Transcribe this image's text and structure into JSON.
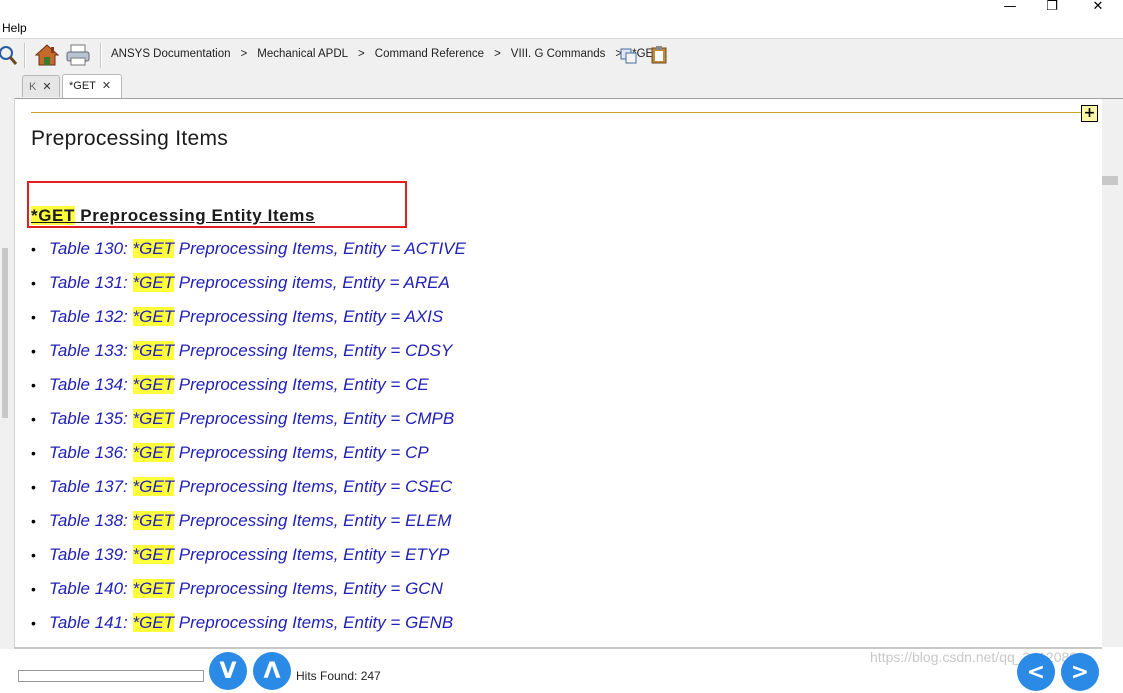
{
  "window": {
    "minimize": "—",
    "restore": "❐",
    "close": "✕"
  },
  "menu": {
    "help": "Help"
  },
  "toolbar": {
    "breadcrumbs": [
      "ANSYS Documentation",
      "Mechanical APDL",
      "Command Reference",
      "VIII. G Commands",
      "*GET"
    ],
    "separator": ">"
  },
  "tabs": [
    {
      "label": "K",
      "close": "✕",
      "active": false
    },
    {
      "label": "*GET",
      "close": "✕",
      "active": true
    }
  ],
  "content": {
    "expand_symbol": "+",
    "section_title": "Preprocessing Items",
    "subheading_highlight": "*GET",
    "subheading_rest": " Preprocessing Entity Items",
    "items": [
      {
        "prefix": "Table 130: ",
        "get": "*GET",
        "rest": " Preprocessing Items, Entity = ACTIVE"
      },
      {
        "prefix": "Table 131: ",
        "get": "*GET",
        "rest": " Preprocessing items, Entity = AREA"
      },
      {
        "prefix": "Table 132: ",
        "get": "*GET",
        "rest": " Preprocessing Items, Entity = AXIS"
      },
      {
        "prefix": "Table 133: ",
        "get": "*GET",
        "rest": " Preprocessing Items, Entity = CDSY"
      },
      {
        "prefix": "Table 134: ",
        "get": "*GET",
        "rest": " Preprocessing Items, Entity = CE"
      },
      {
        "prefix": "Table 135: ",
        "get": "*GET",
        "rest": " Preprocessing Items, Entity = CMPB"
      },
      {
        "prefix": "Table 136: ",
        "get": "*GET",
        "rest": " Preprocessing Items, Entity = CP"
      },
      {
        "prefix": "Table 137: ",
        "get": "*GET",
        "rest": " Preprocessing Items, Entity = CSEC"
      },
      {
        "prefix": "Table 138: ",
        "get": "*GET",
        "rest": " Preprocessing Items, Entity = ELEM"
      },
      {
        "prefix": "Table 139: ",
        "get": "*GET",
        "rest": " Preprocessing Items, Entity = ETYP"
      },
      {
        "prefix": "Table 140: ",
        "get": "*GET",
        "rest": " Preprocessing Items, Entity = GCN"
      },
      {
        "prefix": "Table 141: ",
        "get": "*GET",
        "rest": " Preprocessing Items, Entity = GENB"
      }
    ]
  },
  "bottom": {
    "down_label": "V",
    "up_label": "Λ",
    "hits_text": "Hits Found: 247",
    "prev_label": "<",
    "next_label": ">",
    "watermark": "https://blog.csdn.net/qq_34120808"
  },
  "colors": {
    "link": "#2121b8",
    "highlight": "#ffff3b",
    "red_box": "#e02020",
    "rule": "#c9a227",
    "nav_button": "#2a8ae6"
  }
}
